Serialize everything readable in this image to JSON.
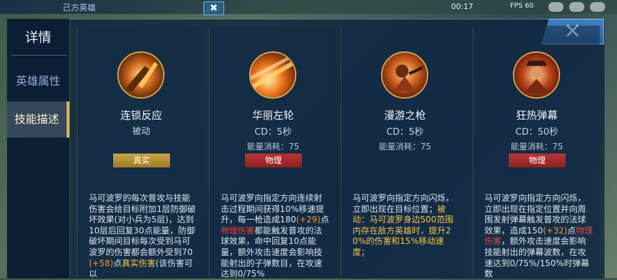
{
  "hud": {
    "team_label": "己方英雄",
    "timer": "00:17",
    "fps": "FPS 60",
    "small_close": "✖"
  },
  "sidebar": {
    "title": "详情",
    "items": [
      {
        "label": "英雄属性",
        "active": false
      },
      {
        "label": "技能描述",
        "active": true
      }
    ]
  },
  "close_button": "✕",
  "skills": [
    {
      "name": "连锁反应",
      "type": "被动",
      "tag": "真实",
      "desc": [
        {
          "t": "马可波罗的每次普攻与技能伤害会给目标附加1层防御破坏效果(对小兵为5层)，达到10层后回复30点能量，防御破坏期间目标每次受到马可波罗的伤害都会额外受到70"
        },
        {
          "t": "(+58)",
          "c": "orange"
        },
        {
          "t": "点"
        },
        {
          "t": "真实伤害",
          "c": "yellow"
        },
        {
          "t": "(该伤害可以"
        }
      ]
    },
    {
      "name": "华丽左轮",
      "cd": "CD：5秒",
      "cost": "能量消耗：75",
      "tag": "物理",
      "desc": [
        {
          "t": "马可波罗向指定方向连续射击过程期间获得10%移速提升，每一枪造成180"
        },
        {
          "t": "(+29)",
          "c": "orange"
        },
        {
          "t": "点"
        },
        {
          "t": "物理伤害",
          "c": "red"
        },
        {
          "t": "都能触发普攻的法球效果，命中回复10点能量，额外攻击速度会影响技能射出的子弹数目，在攻速达到0/75%"
        }
      ]
    },
    {
      "name": "漫游之枪",
      "cd": "CD：5秒",
      "cost": "能量消耗：75",
      "desc": [
        {
          "t": "马可波罗向指定方向闪烁，立即出现在目标位置；"
        },
        {
          "t": "被动：马可波罗身边500范围内存在敌方英雄时，提升20%的伤害和15%移动速度；",
          "c": "yellow"
        }
      ]
    },
    {
      "name": "狂热弹幕",
      "cd": "CD：50秒",
      "cost": "能量消耗：75",
      "tag": "物理",
      "desc": [
        {
          "t": "马可波罗向指定方向闪烁，立即出现在指定位置并向周围发射弹幕触发普攻的法球效果，造成150"
        },
        {
          "t": "(+32)",
          "c": "orange"
        },
        {
          "t": "点"
        },
        {
          "t": "物理伤害",
          "c": "red"
        },
        {
          "t": "，额外攻击速度会影响技能射出的弹幕波数，在攻速达到0/75%/150%时弹幕数"
        }
      ]
    }
  ]
}
